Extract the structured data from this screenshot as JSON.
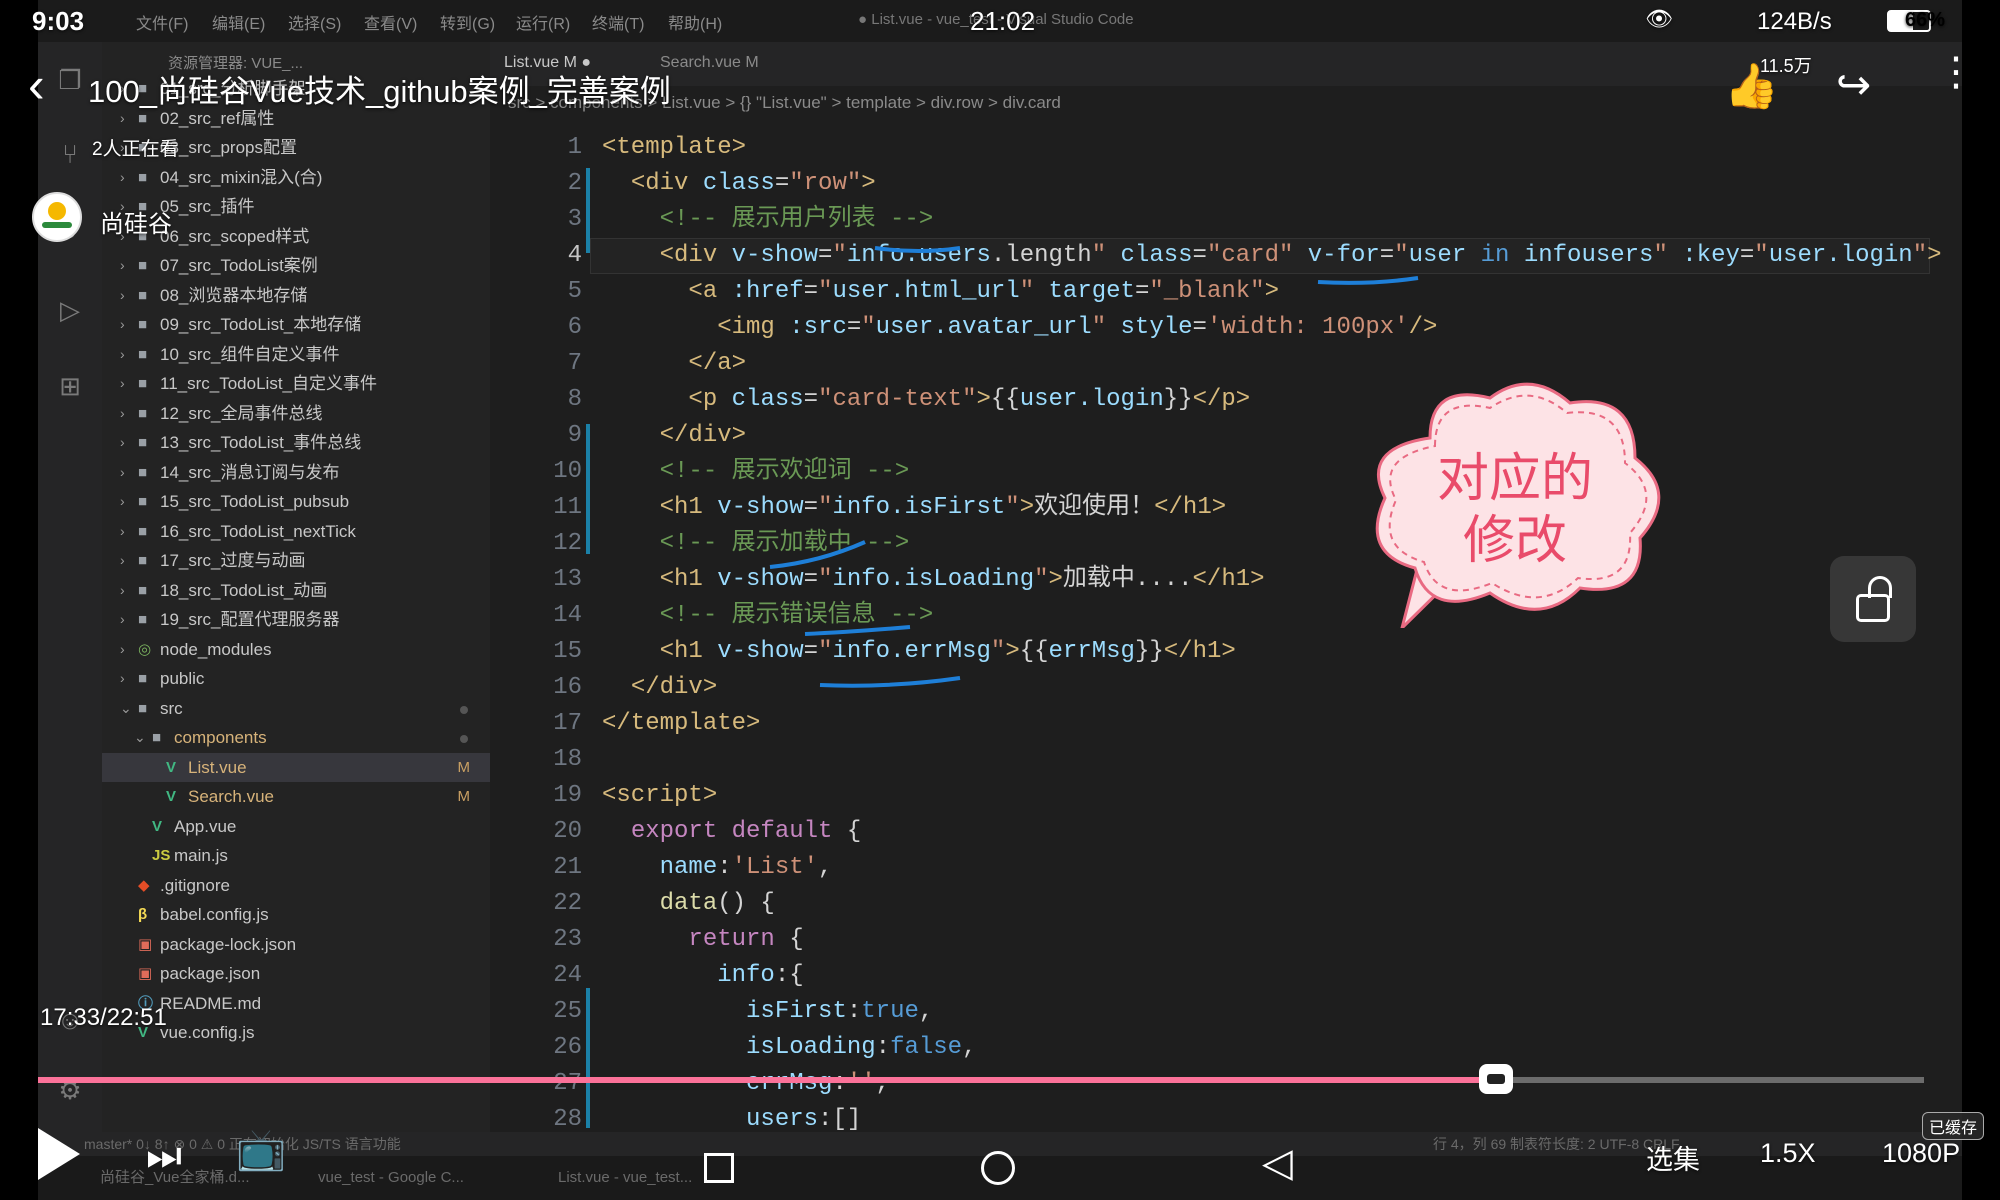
{
  "phone_status": {
    "time": "9:03",
    "net_speed": "124B/s",
    "battery": "66%"
  },
  "video": {
    "title": "100_尚硅谷Vue技术_github案例_完善案例",
    "clock": "21:02",
    "viewers": "2人正在看",
    "channel_name": "尚硅谷",
    "likes": "11.5万",
    "timestamp": "17:33/22:51",
    "progress_percent": 77.3,
    "episodes_label": "选集",
    "speed_label": "1.5X",
    "quality_label": "1080P",
    "cached_label": "已缓存"
  },
  "vscode": {
    "menus": [
      "文件(F)",
      "编辑(E)",
      "选择(S)",
      "查看(V)",
      "转到(G)",
      "运行(R)",
      "终端(T)",
      "帮助(H)"
    ],
    "window_title": "● List.vue - vue_test - Visual Studio Code",
    "explorer_header": "资源管理器: VUE_...",
    "tabs": [
      "List.vue M ●",
      "Search.vue M"
    ],
    "breadcrumb": "src > components > List.vue > {} \"List.vue\" > template > div.row > div.card",
    "tree": [
      {
        "name": "01_src_分析脚手架",
        "type": "folder",
        "indent": 1
      },
      {
        "name": "02_src_ref属性",
        "type": "folder",
        "indent": 1
      },
      {
        "name": "03_src_props配置",
        "type": "folder",
        "indent": 1
      },
      {
        "name": "04_src_mixin混入(合)",
        "type": "folder",
        "indent": 1
      },
      {
        "name": "05_src_插件",
        "type": "folder",
        "indent": 1
      },
      {
        "name": "06_src_scoped样式",
        "type": "folder",
        "indent": 1
      },
      {
        "name": "07_src_TodoList案例",
        "type": "folder",
        "indent": 1
      },
      {
        "name": "08_浏览器本地存储",
        "type": "folder",
        "indent": 1
      },
      {
        "name": "09_src_TodoList_本地存储",
        "type": "folder",
        "indent": 1
      },
      {
        "name": "10_src_组件自定义事件",
        "type": "folder",
        "indent": 1
      },
      {
        "name": "11_src_TodoList_自定义事件",
        "type": "folder",
        "indent": 1
      },
      {
        "name": "12_src_全局事件总线",
        "type": "folder",
        "indent": 1
      },
      {
        "name": "13_src_TodoList_事件总线",
        "type": "folder",
        "indent": 1
      },
      {
        "name": "14_src_消息订阅与发布",
        "type": "folder",
        "indent": 1
      },
      {
        "name": "15_src_TodoList_pubsub",
        "type": "folder",
        "indent": 1
      },
      {
        "name": "16_src_TodoList_nextTick",
        "type": "folder",
        "indent": 1
      },
      {
        "name": "17_src_过度与动画",
        "type": "folder",
        "indent": 1
      },
      {
        "name": "18_src_TodoList_动画",
        "type": "folder",
        "indent": 1
      },
      {
        "name": "19_src_配置代理服务器",
        "type": "folder",
        "indent": 1
      },
      {
        "name": "node_modules",
        "type": "module",
        "indent": 1
      },
      {
        "name": "public",
        "type": "folder",
        "indent": 1
      },
      {
        "name": "src",
        "type": "folder-open",
        "indent": 1,
        "dot": true
      },
      {
        "name": "components",
        "type": "folder-open",
        "indent": 2,
        "dot": true
      },
      {
        "name": "List.vue",
        "type": "vue",
        "indent": 3,
        "badge": "M",
        "selected": true
      },
      {
        "name": "Search.vue",
        "type": "vue",
        "indent": 3,
        "badge": "M"
      },
      {
        "name": "App.vue",
        "type": "vue",
        "indent": 2
      },
      {
        "name": "main.js",
        "type": "js",
        "indent": 2
      },
      {
        "name": ".gitignore",
        "type": "git",
        "indent": 1
      },
      {
        "name": "babel.config.js",
        "type": "babel",
        "indent": 1
      },
      {
        "name": "package-lock.json",
        "type": "json",
        "indent": 1
      },
      {
        "name": "package.json",
        "type": "json",
        "indent": 1
      },
      {
        "name": "README.md",
        "type": "md",
        "indent": 1
      },
      {
        "name": "vue.config.js",
        "type": "vue",
        "indent": 1
      }
    ],
    "code_lines": [
      [
        [
          "t",
          "<template>"
        ]
      ],
      [
        [
          "p",
          "  "
        ],
        [
          "t",
          "<div"
        ],
        [
          "a",
          " class"
        ],
        [
          "p",
          "="
        ],
        [
          "s",
          "\"row\""
        ],
        [
          "t",
          ">"
        ]
      ],
      [
        [
          "p",
          "    "
        ],
        [
          "c",
          "<!-- 展示用户列表 -->"
        ]
      ],
      [
        [
          "p",
          "    "
        ],
        [
          "t",
          "<div"
        ],
        [
          "a",
          " v-show"
        ],
        [
          "p",
          "="
        ],
        [
          "s",
          "\""
        ],
        [
          "a",
          "info.users"
        ],
        [
          "p",
          ".length"
        ],
        [
          "s",
          "\""
        ],
        [
          "a",
          " class"
        ],
        [
          "p",
          "="
        ],
        [
          "s",
          "\"card\""
        ],
        [
          "a",
          " v-for"
        ],
        [
          "p",
          "="
        ],
        [
          "s",
          "\""
        ],
        [
          "a",
          "user"
        ],
        [
          "b",
          " in "
        ],
        [
          "a",
          "infousers"
        ],
        [
          "s",
          "\""
        ],
        [
          "a",
          " :key"
        ],
        [
          "p",
          "="
        ],
        [
          "s",
          "\""
        ],
        [
          "a",
          "user.login"
        ],
        [
          "s",
          "\""
        ],
        [
          "t",
          ">"
        ]
      ],
      [
        [
          "p",
          "      "
        ],
        [
          "t",
          "<a"
        ],
        [
          "a",
          " :href"
        ],
        [
          "p",
          "="
        ],
        [
          "s",
          "\""
        ],
        [
          "a",
          "user.html_url"
        ],
        [
          "s",
          "\""
        ],
        [
          "a",
          " target"
        ],
        [
          "p",
          "="
        ],
        [
          "s",
          "\"_blank\""
        ],
        [
          "t",
          ">"
        ]
      ],
      [
        [
          "p",
          "        "
        ],
        [
          "t",
          "<img"
        ],
        [
          "a",
          " :src"
        ],
        [
          "p",
          "="
        ],
        [
          "s",
          "\""
        ],
        [
          "a",
          "user.avatar_url"
        ],
        [
          "s",
          "\""
        ],
        [
          "a",
          " style"
        ],
        [
          "p",
          "="
        ],
        [
          "s",
          "'width: 100px'"
        ],
        [
          "t",
          "/>"
        ]
      ],
      [
        [
          "p",
          "      "
        ],
        [
          "t",
          "</a>"
        ]
      ],
      [
        [
          "p",
          "      "
        ],
        [
          "t",
          "<p"
        ],
        [
          "a",
          " class"
        ],
        [
          "p",
          "="
        ],
        [
          "s",
          "\"card-text\""
        ],
        [
          "t",
          ">"
        ],
        [
          "p",
          "{{"
        ],
        [
          "a",
          "user.login"
        ],
        [
          "p",
          "}}"
        ],
        [
          "t",
          "</p>"
        ]
      ],
      [
        [
          "p",
          "    "
        ],
        [
          "t",
          "</div>"
        ]
      ],
      [
        [
          "p",
          "    "
        ],
        [
          "c",
          "<!-- 展示欢迎词 -->"
        ]
      ],
      [
        [
          "p",
          "    "
        ],
        [
          "t",
          "<h1"
        ],
        [
          "a",
          " v-show"
        ],
        [
          "p",
          "="
        ],
        [
          "s",
          "\""
        ],
        [
          "a",
          "info.isFirst"
        ],
        [
          "s",
          "\""
        ],
        [
          "t",
          ">"
        ],
        [
          "p",
          "欢迎使用！"
        ],
        [
          "t",
          "</h1>"
        ]
      ],
      [
        [
          "p",
          "    "
        ],
        [
          "c",
          "<!-- 展示加载中 -->"
        ]
      ],
      [
        [
          "p",
          "    "
        ],
        [
          "t",
          "<h1"
        ],
        [
          "a",
          " v-show"
        ],
        [
          "p",
          "="
        ],
        [
          "s",
          "\""
        ],
        [
          "a",
          "info.isLoading"
        ],
        [
          "s",
          "\""
        ],
        [
          "t",
          ">"
        ],
        [
          "p",
          "加载中...."
        ],
        [
          "t",
          "</h1>"
        ]
      ],
      [
        [
          "p",
          "    "
        ],
        [
          "c",
          "<!-- 展示错误信息 -->"
        ]
      ],
      [
        [
          "p",
          "    "
        ],
        [
          "t",
          "<h1"
        ],
        [
          "a",
          " v-show"
        ],
        [
          "p",
          "="
        ],
        [
          "s",
          "\""
        ],
        [
          "a",
          "info.errMsg"
        ],
        [
          "s",
          "\""
        ],
        [
          "t",
          ">"
        ],
        [
          "p",
          "{{"
        ],
        [
          "a",
          "errMsg"
        ],
        [
          "p",
          "}}"
        ],
        [
          "t",
          "</h1>"
        ]
      ],
      [
        [
          "p",
          "  "
        ],
        [
          "t",
          "</div>"
        ]
      ],
      [
        [
          "t",
          "</template>"
        ]
      ],
      [
        [
          "p",
          ""
        ]
      ],
      [
        [
          "t",
          "<script>"
        ]
      ],
      [
        [
          "p",
          "  "
        ],
        [
          "k",
          "export default"
        ],
        [
          "p",
          " {"
        ]
      ],
      [
        [
          "p",
          "    "
        ],
        [
          "a",
          "name"
        ],
        [
          "p",
          ":"
        ],
        [
          "s",
          "'List'"
        ],
        [
          "p",
          ","
        ]
      ],
      [
        [
          "p",
          "    "
        ],
        [
          "f",
          "data"
        ],
        [
          "p",
          "() {"
        ]
      ],
      [
        [
          "p",
          "      "
        ],
        [
          "k",
          "return"
        ],
        [
          "p",
          " {"
        ]
      ],
      [
        [
          "p",
          "        "
        ],
        [
          "a",
          "info"
        ],
        [
          "p",
          ":{"
        ]
      ],
      [
        [
          "p",
          "          "
        ],
        [
          "a",
          "isFirst"
        ],
        [
          "p",
          ":"
        ],
        [
          "b",
          "true"
        ],
        [
          "p",
          ","
        ]
      ],
      [
        [
          "p",
          "          "
        ],
        [
          "a",
          "isLoading"
        ],
        [
          "p",
          ":"
        ],
        [
          "b",
          "false"
        ],
        [
          "p",
          ","
        ]
      ],
      [
        [
          "p",
          "          "
        ],
        [
          "a",
          "errMsg"
        ],
        [
          "p",
          ":"
        ],
        [
          "s",
          "''"
        ],
        [
          "p",
          ","
        ]
      ],
      [
        [
          "p",
          "          "
        ],
        [
          "a",
          "users"
        ],
        [
          "p",
          ":[]"
        ]
      ]
    ],
    "current_line": 4,
    "status_left": "master*   0↓ 8↑   ⊗ 0 ⚠ 0   正在初始化 JS/TS 语言功能",
    "status_right": "行 4，列 69   制表符长度: 2   UTF-8   CRLF",
    "taskbar_items": [
      "尚硅谷_Vue全家桶.d...",
      "vue_test - Google C...",
      "List.vue - vue_test..."
    ],
    "annotation": "对应的\n修改"
  },
  "colors": {
    "accent": "#fb7299",
    "tag": "#d7ba7d",
    "attr": "#9cdcfe",
    "string": "#ce9178",
    "comment": "#6a9955"
  }
}
